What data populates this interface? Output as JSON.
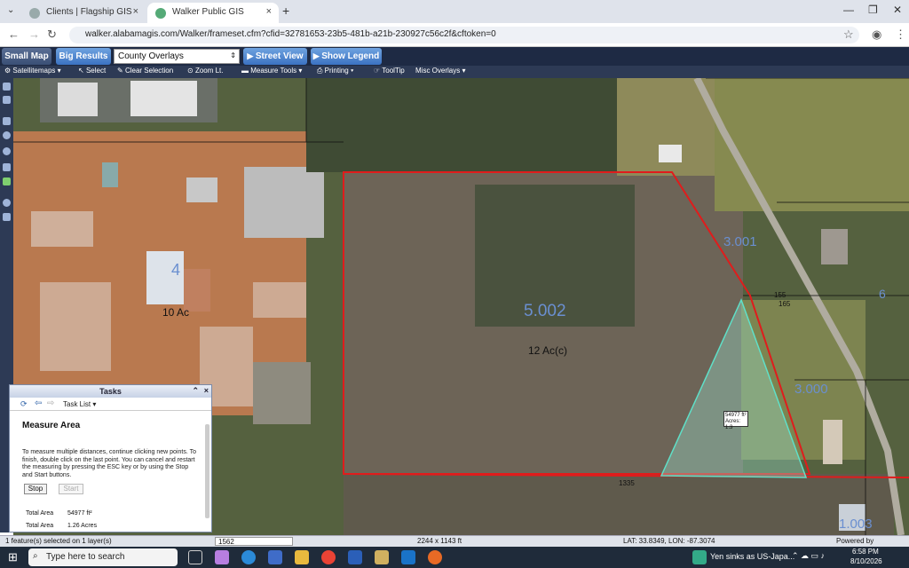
{
  "browser": {
    "tabs": [
      {
        "label": "Clients | Flagship GIS",
        "active": false
      },
      {
        "label": "Walker Public GIS",
        "active": true
      }
    ],
    "new_tab": "+",
    "url": "walker.alabamagis.com/Walker/frameset.cfm?cfid=32781653-23b5-481b-a21b-230927c56c2f&cftoken=0"
  },
  "toolbar1": {
    "small_map": "Small Map",
    "big_results": "Big Results",
    "overlay_select": "County Overlays",
    "street_view": "Street View",
    "show_legend": "Show Legend"
  },
  "toolbar2": {
    "satellite": "Satellitemaps ▾",
    "select": "Select",
    "clear": "Clear Selection",
    "zoom": "Zoom Lt.",
    "measure": "Measure Tools ▾",
    "printing": "Printing ▾",
    "tooltip": "ToolTip",
    "misc": "Misc Overlays ▾"
  },
  "map": {
    "parcel_left_id": "4",
    "parcel_left_acres": "10 Ac",
    "parcel_main_id": "5.002",
    "parcel_main_acres": "12 Ac(c)",
    "parcel_right_id": "3.001",
    "parcel_right2_id": "3.000",
    "parcel_far_right": "6",
    "label_155": "155",
    "label_165": "165",
    "label_1335": "1335",
    "label_1003": "1.003",
    "measure_label_1": "54977 ft²",
    "measure_label_2": "Acres: 1.3"
  },
  "task_panel": {
    "title": "Tasks",
    "task_list": "Task List ▾",
    "heading": "Measure Area",
    "instructions": "To measure multiple distances, continue clicking new points. To finish, double click on the last point. You can cancel and restart the measuring by pressing the ESC key or by using the Stop and Start buttons.",
    "stop": "Stop",
    "start": "Start",
    "result_label_1": "Total Area",
    "result_value_1": "54977 ft²",
    "result_label_2": "Total Area",
    "result_value_2": "1.26 Acres"
  },
  "status": {
    "selected": "1 feature(s) selected on 1 layer(s)",
    "scale": "1562",
    "extent": "2244 x 1143 ft",
    "coords": "LAT: 33.8349, LON: -87.3074",
    "powered": "Powered by"
  },
  "taskbar": {
    "search_placeholder": "Type here to search",
    "news": "Yen sinks as US-Japa...",
    "time": "6:58 PM",
    "date": "8/10/2026"
  }
}
